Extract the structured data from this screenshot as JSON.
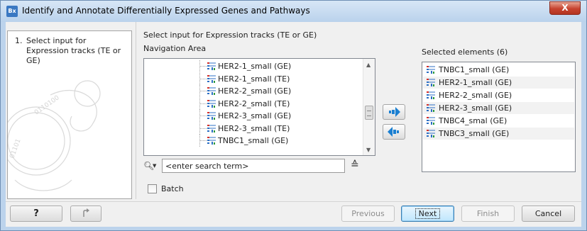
{
  "window": {
    "title": "Identify and Annotate Differentially Expressed Genes and Pathways",
    "app_icon_text": "Bx",
    "close_symbol": "X"
  },
  "steps": {
    "number": "1.",
    "text": "Select input for Expression tracks (TE or GE)"
  },
  "main": {
    "heading": "Select input for Expression tracks (TE or GE)",
    "navigation_label": "Navigation Area",
    "selected_label": "Selected elements (6)"
  },
  "navigation_items": [
    {
      "label": "HER2-1_small (GE)",
      "icon": "expression-track-icon"
    },
    {
      "label": "HER2-1_small (TE)",
      "icon": "expression-track-icon"
    },
    {
      "label": "HER2-2_small (GE)",
      "icon": "expression-track-icon"
    },
    {
      "label": "HER2-2_small (TE)",
      "icon": "expression-track-icon"
    },
    {
      "label": "HER2-3_small (GE)",
      "icon": "expression-track-icon"
    },
    {
      "label": "HER2-3_small (TE)",
      "icon": "expression-track-icon"
    },
    {
      "label": "TNBC1_small (GE)",
      "icon": "expression-track-icon"
    }
  ],
  "selected_items": [
    {
      "label": "TNBC1_small (GE)",
      "icon": "expression-track-icon"
    },
    {
      "label": "HER2-1_small (GE)",
      "icon": "expression-track-icon"
    },
    {
      "label": "HER2-2_small (GE)",
      "icon": "expression-track-icon"
    },
    {
      "label": "HER2-3_small (GE)",
      "icon": "expression-track-icon"
    },
    {
      "label": "TNBC4_smal (GE)",
      "icon": "expression-track-icon"
    },
    {
      "label": "TNBC3_small (GE)",
      "icon": "expression-track-icon"
    }
  ],
  "search": {
    "placeholder": "<enter search term>"
  },
  "batch": {
    "label": "Batch",
    "checked": false
  },
  "buttons": {
    "help": "?",
    "previous": "Previous",
    "next": "Next",
    "finish": "Finish",
    "cancel": "Cancel"
  },
  "colors": {
    "title_bar": "#bcd3ec",
    "close_button": "#c7432f",
    "arrow_icon": "#1a7fd1"
  }
}
